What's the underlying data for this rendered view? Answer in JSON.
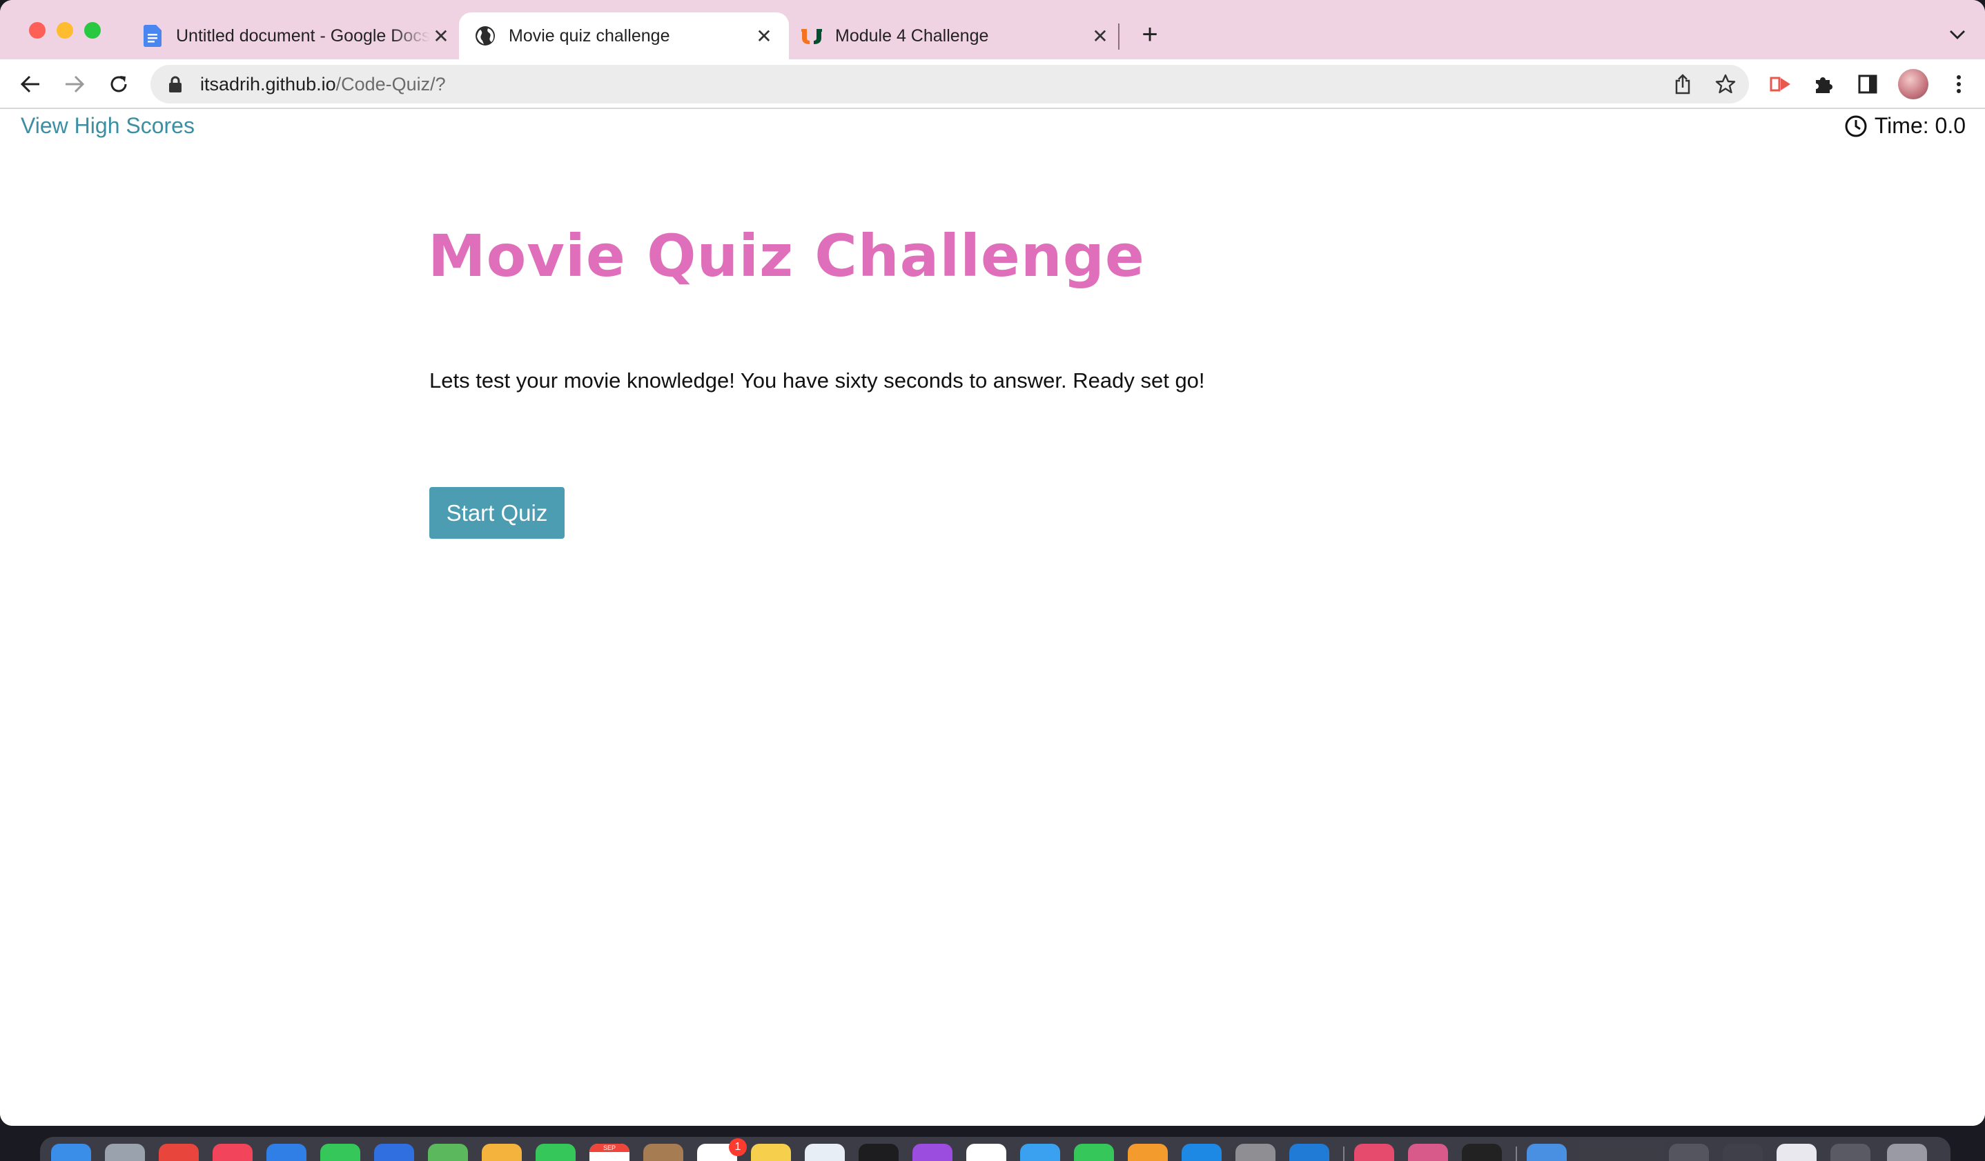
{
  "browser": {
    "tabs": [
      {
        "title": "Untitled document - Google Docs",
        "favicon": "google-docs-icon",
        "active": false
      },
      {
        "title": "Movie quiz challenge",
        "favicon": "globe-icon",
        "active": true
      },
      {
        "title": "Module 4 Challenge",
        "favicon": "university-icon",
        "active": false
      }
    ],
    "url_host": "itsadrih.github.io",
    "url_path": "/Code-Quiz/?"
  },
  "page": {
    "high_scores_link": "View High Scores",
    "timer_text": "Time: 0.0",
    "title": "Movie Quiz Challenge",
    "description": "Lets test your movie knowledge! You have sixty seconds to answer. Ready set go!",
    "start_button": "Start Quiz"
  },
  "dock": {
    "calendar_label": "SEP",
    "reminders_badge": "1"
  },
  "colors": {
    "tabstrip": "#f0d3e2",
    "title_pink": "#df6fba",
    "link_teal": "#3a8fa3",
    "button_teal": "#4c9db2"
  }
}
